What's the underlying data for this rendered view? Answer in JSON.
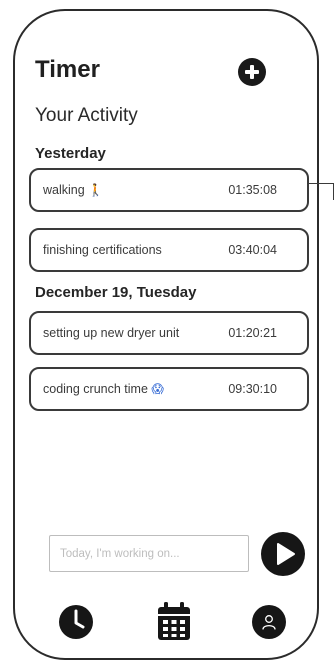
{
  "header": {
    "title": "Timer",
    "add_icon": "plus-circle-icon"
  },
  "activity": {
    "section_title": "Your Activity",
    "groups": [
      {
        "label": "Yesterday",
        "entries": [
          {
            "name": "walking",
            "emoji": "🚶",
            "time": "01:35:08"
          },
          {
            "name": "finishing certifications",
            "emoji": "",
            "time": "03:40:04"
          }
        ]
      },
      {
        "label": "December 19, Tuesday",
        "entries": [
          {
            "name": "setting up new dryer unit",
            "emoji": "",
            "time": "01:20:21"
          },
          {
            "name": "coding crunch time",
            "emoji": "😱",
            "time": "09:30:10"
          }
        ]
      }
    ]
  },
  "composer": {
    "placeholder": "Today, I'm working on...",
    "value": "",
    "start_icon": "play-circle-icon"
  },
  "bottom_nav": [
    {
      "icon": "clock-icon"
    },
    {
      "icon": "calendar-icon"
    },
    {
      "icon": "user-profile-icon"
    }
  ],
  "colors": {
    "ink": "#1a1a1a",
    "card_border": "#3a3a3a",
    "muted_text": "#3b3b3b",
    "placeholder": "#bdbdbd",
    "background": "#ffffff"
  }
}
